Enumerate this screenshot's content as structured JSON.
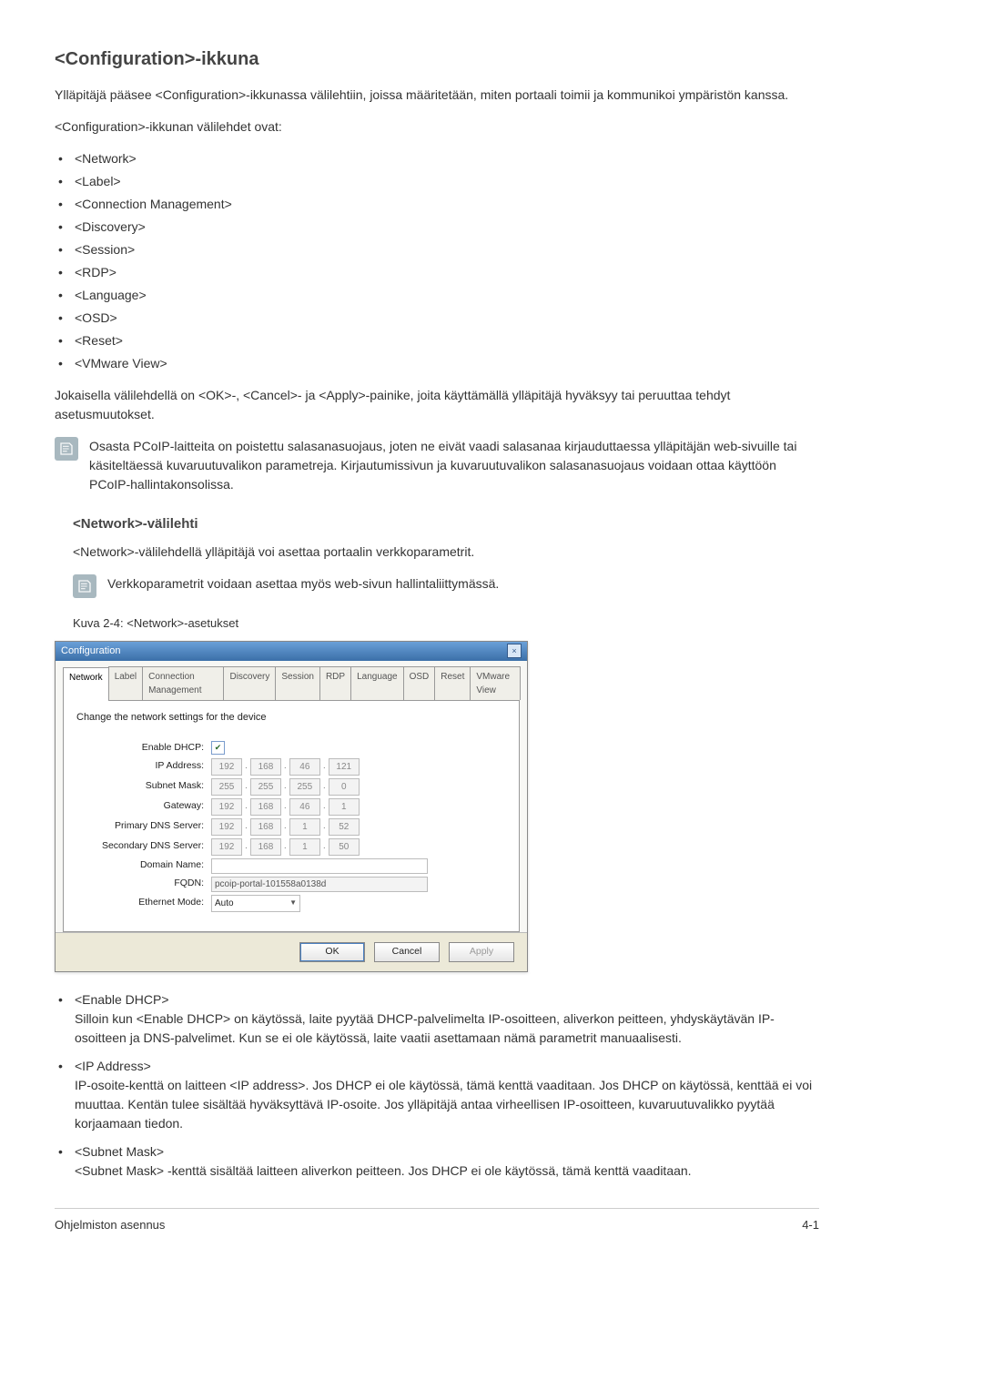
{
  "heading": "<Configuration>-ikkuna",
  "intro": "Ylläpitäjä pääsee <Configuration>-ikkunassa välilehtiin, joissa määritetään, miten portaali toimii ja kommunikoi ympäristön kanssa.",
  "tabs_intro": "<Configuration>-ikkunan välilehdet ovat:",
  "tabs_list": [
    "<Network>",
    "<Label>",
    "<Connection Management>",
    "<Discovery>",
    "<Session>",
    "<RDP>",
    "<Language>",
    "<OSD>",
    "<Reset>",
    "<VMware View>"
  ],
  "buttons_para": "Jokaisella välilehdellä on <OK>-, <Cancel>- ja <Apply>-painike, joita käyttämällä ylläpitäjä hyväksyy tai peruuttaa tehdyt asetusmuutokset.",
  "note1": "Osasta PCoIP-laitteita on poistettu salasanasuojaus, joten ne eivät vaadi salasanaa kirjauduttaessa ylläpitäjän web-sivuille tai käsiteltäessä kuvaruutuvalikon parametreja. Kirjautumissivun ja kuvaruutuvalikon salasanasuojaus voidaan ottaa käyttöön PCoIP-hallintakonsolissa.",
  "network_heading": "<Network>-välilehti",
  "network_intro": "<Network>-välilehdellä ylläpitäjä voi asettaa portaalin verkkoparametrit.",
  "note2": "Verkkoparametrit voidaan asettaa myös web-sivun hallintaliittymässä.",
  "figure_caption": "Kuva 2-4: <Network>-asetukset",
  "win": {
    "title": "Configuration",
    "tabs": [
      "Network",
      "Label",
      "Connection Management",
      "Discovery",
      "Session",
      "RDP",
      "Language",
      "OSD",
      "Reset",
      "VMware View"
    ],
    "active_tab_index": 0,
    "panel_heading": "Change the network settings for the device",
    "fields": {
      "enable_dhcp": {
        "label": "Enable DHCP:",
        "checked": true
      },
      "ip_address": {
        "label": "IP Address:",
        "octets": [
          "192",
          "168",
          "46",
          "121"
        ]
      },
      "subnet_mask": {
        "label": "Subnet Mask:",
        "octets": [
          "255",
          "255",
          "255",
          "0"
        ]
      },
      "gateway": {
        "label": "Gateway:",
        "octets": [
          "192",
          "168",
          "46",
          "1"
        ]
      },
      "primary_dns": {
        "label": "Primary DNS Server:",
        "octets": [
          "192",
          "168",
          "1",
          "52"
        ]
      },
      "secondary_dns": {
        "label": "Secondary DNS Server:",
        "octets": [
          "192",
          "168",
          "1",
          "50"
        ]
      },
      "domain_name": {
        "label": "Domain Name:",
        "value": ""
      },
      "fqdn": {
        "label": "FQDN:",
        "value": "pcoip-portal-101558a0138d"
      },
      "ethernet_mode": {
        "label": "Ethernet Mode:",
        "value": "Auto"
      }
    },
    "buttons": {
      "ok": "OK",
      "cancel": "Cancel",
      "apply": "Apply"
    }
  },
  "descriptions": [
    {
      "term": "<Enable DHCP>",
      "def": "Silloin kun <Enable DHCP> on käytössä, laite pyytää DHCP-palvelimelta IP-osoitteen, aliverkon peitteen, yhdyskäytävän IP-osoitteen ja DNS-palvelimet. Kun se ei ole käytössä, laite vaatii asettamaan nämä parametrit manuaalisesti."
    },
    {
      "term": "<IP Address>",
      "def": "IP-osoite-kenttä on laitteen <IP address>. Jos DHCP ei ole käytössä, tämä kenttä vaaditaan. Jos DHCP on käytössä, kenttää ei voi muuttaa. Kentän tulee sisältää hyväksyttävä IP-osoite. Jos ylläpitäjä antaa virheellisen IP-osoitteen, kuvaruutuvalikko pyytää korjaamaan tiedon."
    },
    {
      "term": "<Subnet Mask>",
      "def": "<Subnet Mask> -kenttä sisältää laitteen aliverkon peitteen. Jos DHCP ei ole käytössä, tämä kenttä vaaditaan."
    }
  ],
  "footer_left": "Ohjelmiston asennus",
  "footer_right": "4-1"
}
